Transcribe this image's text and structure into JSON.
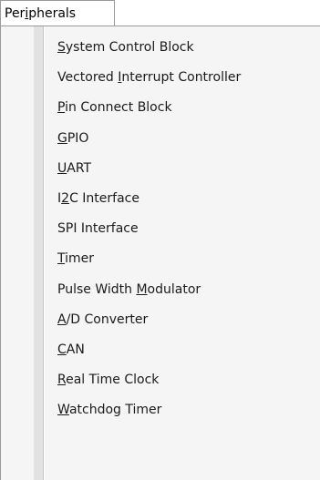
{
  "menubar": {
    "tab": {
      "pre": "Per",
      "mnemonic": "i",
      "post": "pherals"
    }
  },
  "menu": {
    "items": [
      {
        "pre": "",
        "mnemonic": "S",
        "post": "ystem Control Block",
        "submenu": true
      },
      {
        "pre": "Vectored ",
        "mnemonic": "I",
        "post": "nterrupt Controller",
        "submenu": false
      },
      {
        "pre": "",
        "mnemonic": "P",
        "post": "in Connect Block",
        "submenu": false
      },
      {
        "pre": "",
        "mnemonic": "G",
        "post": "PIO",
        "submenu": true
      },
      {
        "pre": "",
        "mnemonic": "U",
        "post": "ART",
        "submenu": true
      },
      {
        "pre": "I",
        "mnemonic": "2",
        "post": "C Interface",
        "submenu": false
      },
      {
        "pre": "SPI Interface",
        "mnemonic": "",
        "post": "",
        "submenu": true
      },
      {
        "pre": "",
        "mnemonic": "T",
        "post": "imer",
        "submenu": true
      },
      {
        "pre": "Pulse Width ",
        "mnemonic": "M",
        "post": "odulator",
        "submenu": false
      },
      {
        "pre": "",
        "mnemonic": "A",
        "post": "/D Converter",
        "submenu": false
      },
      {
        "pre": "",
        "mnemonic": "C",
        "post": "AN",
        "submenu": true
      },
      {
        "pre": "",
        "mnemonic": "R",
        "post": "eal Time Clock",
        "submenu": false
      },
      {
        "pre": "",
        "mnemonic": "W",
        "post": "atchdog Timer",
        "submenu": false
      }
    ]
  }
}
